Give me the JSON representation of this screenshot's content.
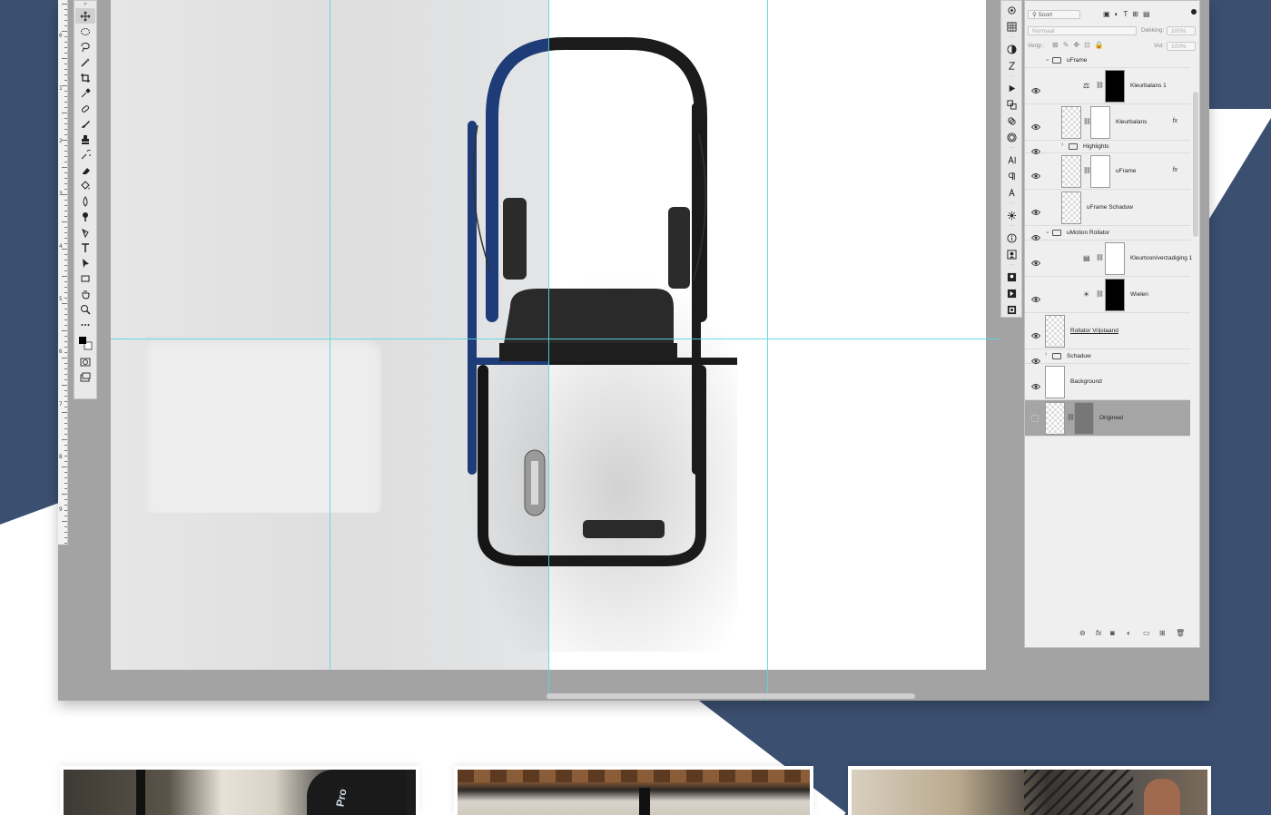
{
  "colors": {
    "navy": "#3b4f70",
    "guide": "#5ad7df",
    "canvas_gray": "#a3a3a3",
    "selected_layer": "#a5a5a5"
  },
  "toolbar": {
    "header": "»",
    "tools": [
      "move-tool-icon",
      "marquee-tool-icon",
      "lasso-tool-icon",
      "magic-wand-icon",
      "crop-tool-icon",
      "eyedropper-icon",
      "healing-brush-icon",
      "brush-tool-icon",
      "clone-stamp-icon",
      "history-brush-icon",
      "eraser-icon",
      "paint-bucket-icon",
      "blur-tool-icon",
      "dodge-tool-icon",
      "pen-tool-icon",
      "type-tool-icon",
      "path-selection-icon",
      "rectangle-tool-icon",
      "hand-tool-icon",
      "zoom-tool-icon",
      "more-tools-icon"
    ]
  },
  "ruler_numbers": [
    "0",
    "1",
    "2",
    "3",
    "4",
    "5",
    "6",
    "7",
    "8",
    "9"
  ],
  "layers_panel": {
    "search_kind": "Soort",
    "blend_mode": "Normaal",
    "opacity_label": "Dekking:",
    "opacity_value": "100%",
    "lock_label": "Vergr.:",
    "fill_label": "Vul:",
    "fill_value": "100%",
    "layers": [
      {
        "name": "uFrame",
        "type": "group"
      },
      {
        "name": "Kleurbalans 1",
        "type": "adjustment"
      },
      {
        "name": "Kleurbalans",
        "type": "layer",
        "fx": "fx"
      },
      {
        "name": "Highlights",
        "type": "group"
      },
      {
        "name": "uFrame",
        "type": "layer",
        "fx": "fx"
      },
      {
        "name": "uFrame Schaduw",
        "type": "layer"
      },
      {
        "name": "uMotion Rollator",
        "type": "group"
      },
      {
        "name": "Kleurtoon/verzadiging 1",
        "type": "adjustment"
      },
      {
        "name": "Wielen",
        "type": "adjustment"
      },
      {
        "name": "Rollator Vrijstaand",
        "type": "layer"
      },
      {
        "name": "Schaduw",
        "type": "group"
      },
      {
        "name": "Background",
        "type": "layer"
      },
      {
        "name": "Origineel",
        "type": "layer",
        "selected": true
      }
    ],
    "footer_fx": "fx"
  }
}
